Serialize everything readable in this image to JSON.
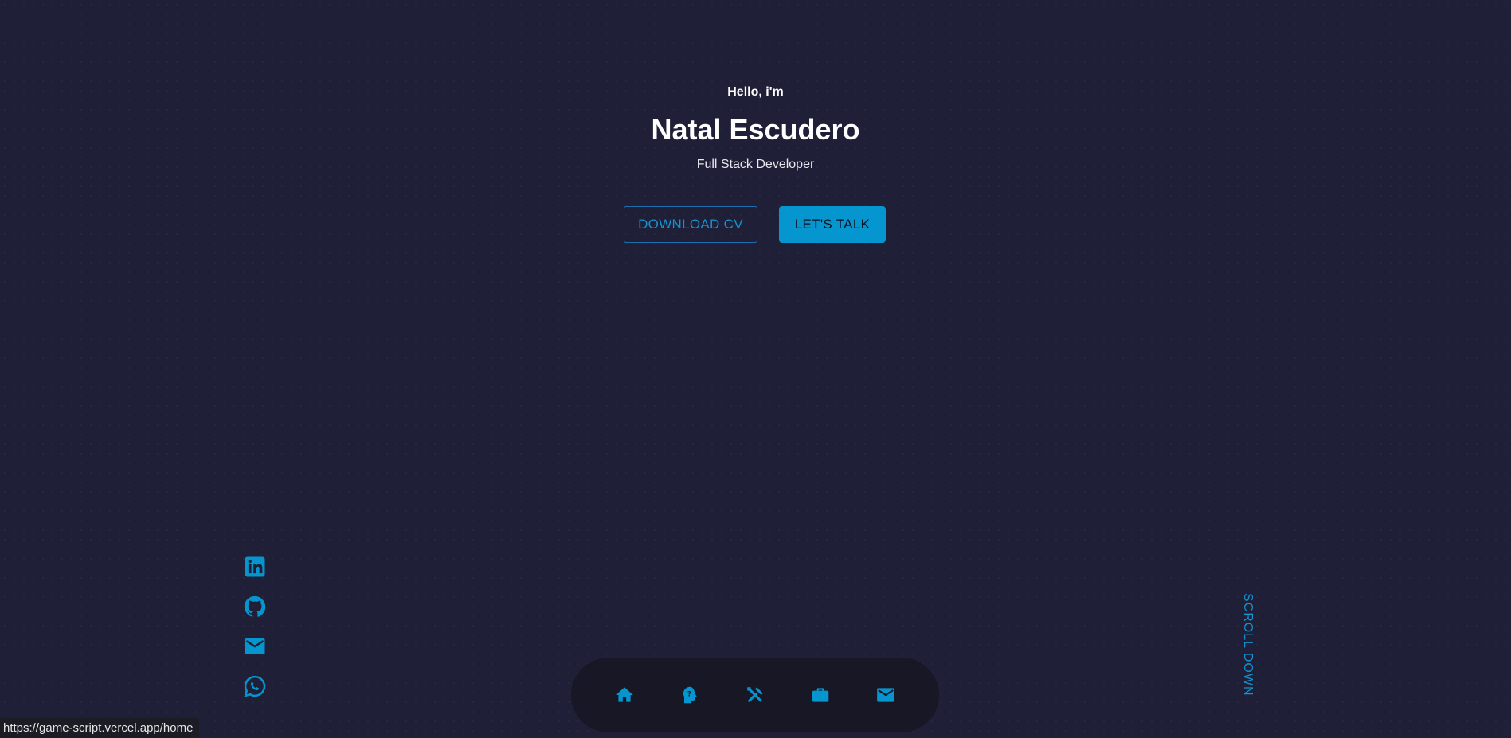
{
  "hero": {
    "greeting": "Hello, i'm",
    "name": "Natal Escudero",
    "role": "Full Stack Developer",
    "download_label": "DOWNLOAD CV",
    "talk_label": "LET'S TALK"
  },
  "socials": [
    {
      "icon": "linkedin-icon"
    },
    {
      "icon": "github-icon"
    },
    {
      "icon": "mail-icon"
    },
    {
      "icon": "whatsapp-icon"
    }
  ],
  "scroll_label": "SCROLL DOWN",
  "nav": [
    {
      "icon": "home-icon"
    },
    {
      "icon": "about-icon"
    },
    {
      "icon": "tools-icon"
    },
    {
      "icon": "briefcase-icon"
    },
    {
      "icon": "mail-icon"
    }
  ],
  "status_bar": {
    "url": "https://game-script.vercel.app/home"
  },
  "colors": {
    "background": "#1f1f37",
    "accent": "#0596d0",
    "nav_background": "#171726"
  }
}
